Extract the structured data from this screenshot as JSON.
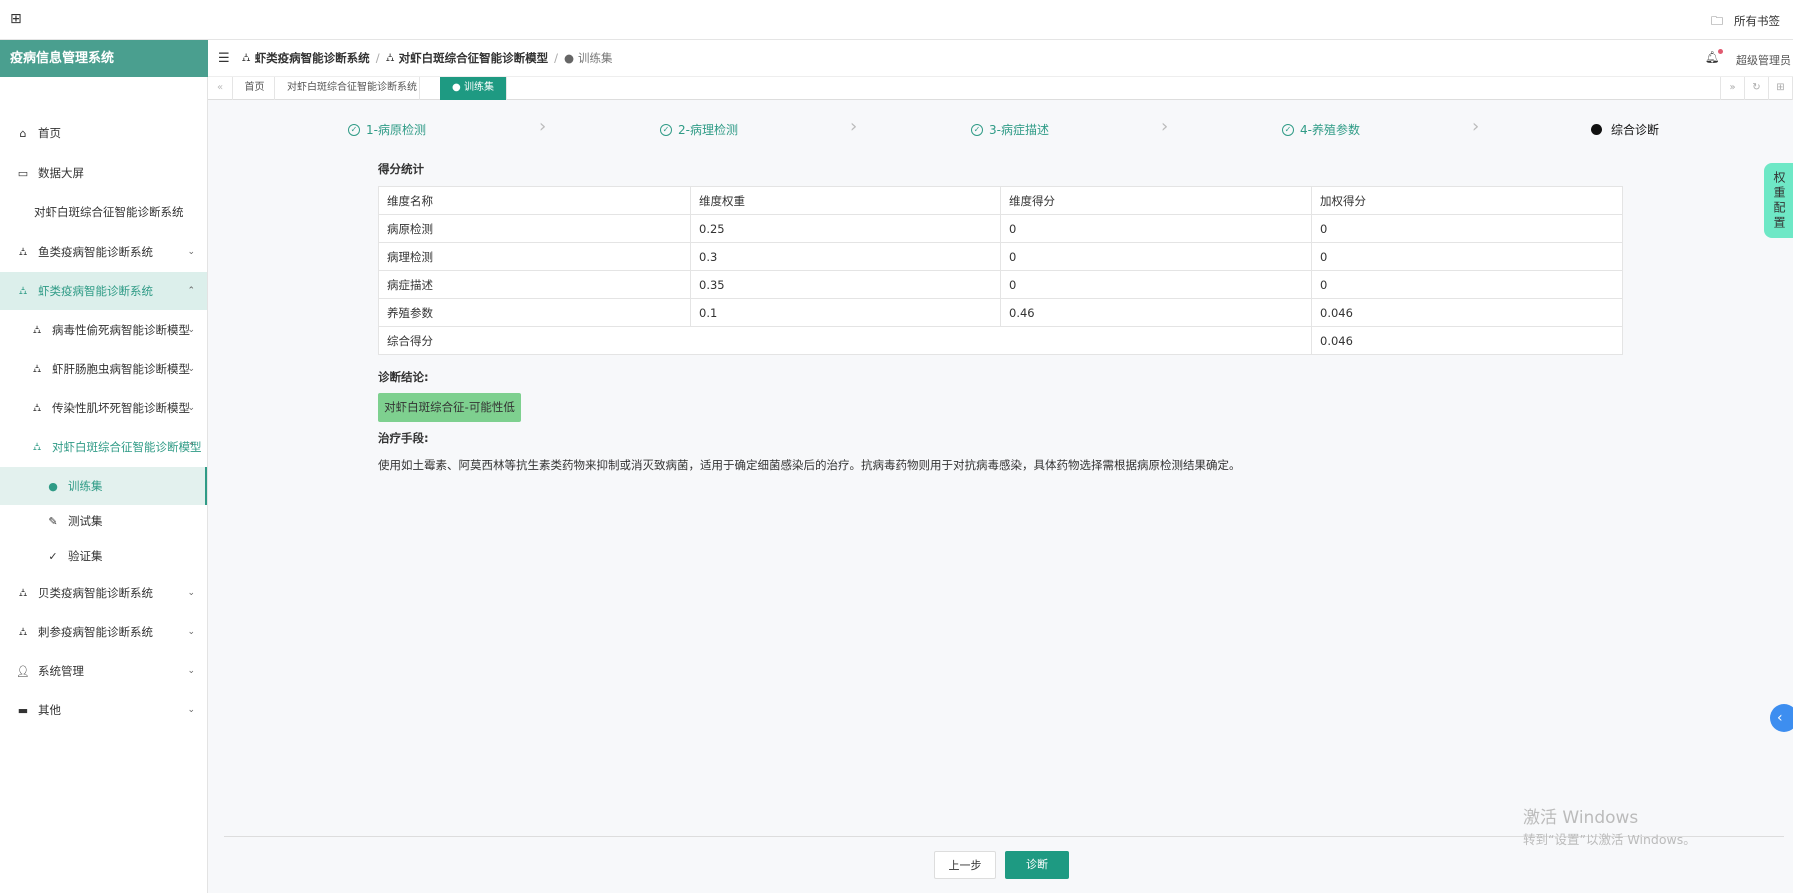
{
  "topbar": {
    "bookmarks": "所有书签"
  },
  "sidebar": {
    "title": "疫病信息管理系统",
    "items": [
      {
        "label": "首页",
        "icon": "home-icon",
        "level": 0
      },
      {
        "label": "数据大屏",
        "icon": "monitor-icon",
        "level": 0
      },
      {
        "label": "对虾白斑综合征智能诊断系统",
        "icon": "",
        "level": 1
      },
      {
        "label": "鱼类疫病智能诊断系统",
        "icon": "sitemap-icon",
        "level": 0,
        "chevron": "down"
      },
      {
        "label": "虾类疫病智能诊断系统",
        "icon": "sitemap-icon",
        "level": 0,
        "chevron": "up",
        "state": "open"
      },
      {
        "label": "病毒性偷死病智能诊断模型",
        "icon": "sitemap-icon",
        "level": 1,
        "chevron": "down"
      },
      {
        "label": "虾肝肠胞虫病智能诊断模型",
        "icon": "sitemap-icon",
        "level": 1,
        "chevron": "down"
      },
      {
        "label": "传染性肌坏死智能诊断模型",
        "icon": "sitemap-icon",
        "level": 1,
        "chevron": "down"
      },
      {
        "label": "对虾白斑综合征智能诊断模型",
        "icon": "sitemap-icon",
        "level": 1,
        "chevron": "up",
        "state": "open-text"
      },
      {
        "label": "训练集",
        "icon": "android-icon",
        "level": 2,
        "state": "active"
      },
      {
        "label": "测试集",
        "icon": "pencil-icon",
        "level": 2
      },
      {
        "label": "验证集",
        "icon": "check-icon",
        "level": 2
      },
      {
        "label": "贝类疫病智能诊断系统",
        "icon": "sitemap-icon",
        "level": 0,
        "chevron": "down"
      },
      {
        "label": "刺参疫病智能诊断系统",
        "icon": "sitemap-icon",
        "level": 0,
        "chevron": "down"
      },
      {
        "label": "系统管理",
        "icon": "user-icon",
        "level": 0,
        "chevron": "down"
      },
      {
        "label": "其他",
        "icon": "briefcase-icon",
        "level": 0,
        "chevron": "down"
      }
    ]
  },
  "header": {
    "breadcrumb": [
      "虾类疫病智能诊断系统",
      "对虾白斑综合征智能诊断模型",
      "训练集"
    ],
    "user": "超级管理员"
  },
  "tabs": [
    "首页",
    "对虾白斑综合征智能诊断系统",
    "训练集"
  ],
  "steps": [
    "1-病原检测",
    "2-病理检测",
    "3-病症描述",
    "4-养殖参数",
    "综合诊断"
  ],
  "score": {
    "title": "得分统计",
    "headers": [
      "维度名称",
      "维度权重",
      "维度得分",
      "加权得分"
    ],
    "rows": [
      [
        "病原检测",
        "0.25",
        "0",
        "0"
      ],
      [
        "病理检测",
        "0.3",
        "0",
        "0"
      ],
      [
        "病症描述",
        "0.35",
        "0",
        "0"
      ],
      [
        "养殖参数",
        "0.1",
        "0.46",
        "0.046"
      ]
    ],
    "total_label": "综合得分",
    "total": "0.046"
  },
  "conclusion": {
    "label": "诊断结论:",
    "result": "对虾白斑综合征-可能性低",
    "result_color": "#7ed08f"
  },
  "treatment": {
    "label": "治疗手段:",
    "text": "使用如土霉素、阿莫西林等抗生素类药物来抑制或消灭致病菌，适用于确定细菌感染后的治疗。抗病毒药物则用于对抗病毒感染，具体药物选择需根据病原检测结果确定。"
  },
  "buttons": {
    "prev": "上一步",
    "diagnose": "诊断"
  },
  "side_tab": "权重配置",
  "watermark": {
    "line1": "激活 Windows",
    "line2": "转到“设置”以激活 Windows。"
  },
  "colors": {
    "primary": "#1e9a82",
    "sidebar_header": "#4a9f8f",
    "side_tab": "#6ee8c6"
  }
}
